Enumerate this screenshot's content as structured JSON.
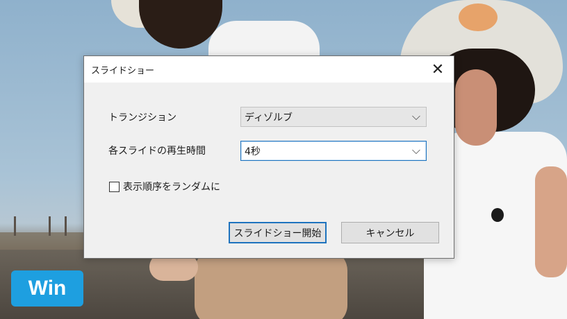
{
  "badge": {
    "label": "Win"
  },
  "dialog": {
    "title": "スライドショー",
    "close_symbol": "✕",
    "transition": {
      "label": "トランジション",
      "value": "ディゾルブ"
    },
    "duration": {
      "label": "各スライドの再生時間",
      "value": "4秒"
    },
    "shuffle": {
      "label": "表示順序をランダムに",
      "checked": false
    },
    "buttons": {
      "start": "スライドショー開始",
      "cancel": "キャンセル"
    }
  },
  "icons": {
    "chevron": "chevron-down-icon",
    "close": "close-icon"
  },
  "colors": {
    "badge": "#1e9fe0",
    "focus": "#1e73be"
  }
}
